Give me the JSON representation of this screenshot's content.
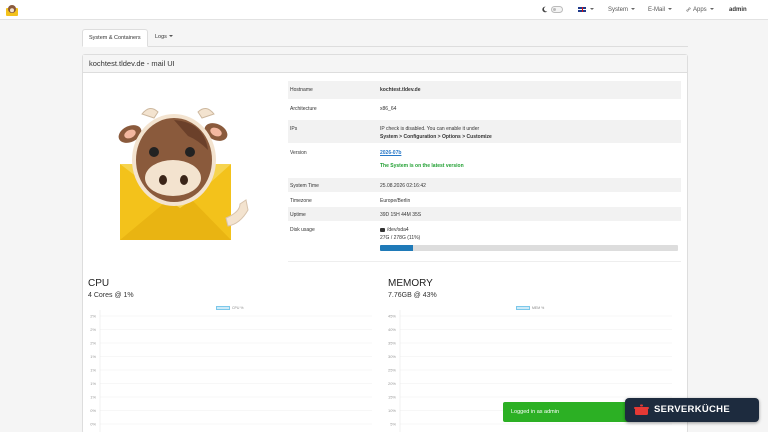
{
  "navbar": {
    "system_label": "System",
    "email_label": "E-Mail",
    "apps_label": "Apps",
    "user_label": "admin"
  },
  "tabs": [
    {
      "label": "System & Containers"
    },
    {
      "label": "Logs"
    }
  ],
  "panel": {
    "title": "kochtest.tldev.de - mail UI"
  },
  "info": {
    "hostname_label": "Hostname",
    "hostname_value": "kochtest.tldev.de",
    "architecture_label": "Architecture",
    "architecture_value": "x86_64",
    "ips_label": "IPs",
    "ips_value_line1": "IP check is disabled. You can enable it under",
    "ips_value_line2": "System > Configuration > Options > Customize",
    "version_label": "Version",
    "version_value": "2026-07b",
    "version_status": "The System is on the latest version",
    "system_time_label": "System Time",
    "system_time_value": "25.08.2026 02:16:42",
    "timezone_label": "Timezone",
    "timezone_value": "Europe/Berlin",
    "uptime_label": "Uptime",
    "uptime_value": "39D 15H 44M 35S",
    "disk_label": "Disk usage",
    "disk_device": "/dev/sda4",
    "disk_usage_text": "27G / 278G (11%)",
    "disk_fraction": 0.11
  },
  "cpu": {
    "title": "CPU",
    "subtitle": "4 Cores @ 1%",
    "legend": "CPU %"
  },
  "memory": {
    "title": "MEMORY",
    "subtitle": "7.76GB @ 43%",
    "legend": "MEM %"
  },
  "chart_data": [
    {
      "type": "area",
      "title": "CPU",
      "series": [
        {
          "name": "CPU %",
          "values": []
        }
      ],
      "y_ticks": [
        "2%",
        "2%",
        "2%",
        "1%",
        "1%",
        "1%",
        "1%",
        "0%",
        "0%"
      ]
    },
    {
      "type": "area",
      "title": "MEMORY",
      "series": [
        {
          "name": "MEM %",
          "values": []
        }
      ],
      "y_ticks": [
        "45%",
        "40%",
        "35%",
        "30%",
        "25%",
        "20%",
        "15%",
        "10%",
        "5%"
      ]
    }
  ],
  "toast": {
    "message": "Logged in as admin"
  },
  "badge": {
    "label": "SERVERKÜCHE"
  },
  "colors": {
    "accent": "#1f7ab8",
    "success": "#2cb024",
    "link": "#2577c8",
    "badge_bg": "#1d2b3e",
    "mascot_body": "#8a5a3c"
  }
}
